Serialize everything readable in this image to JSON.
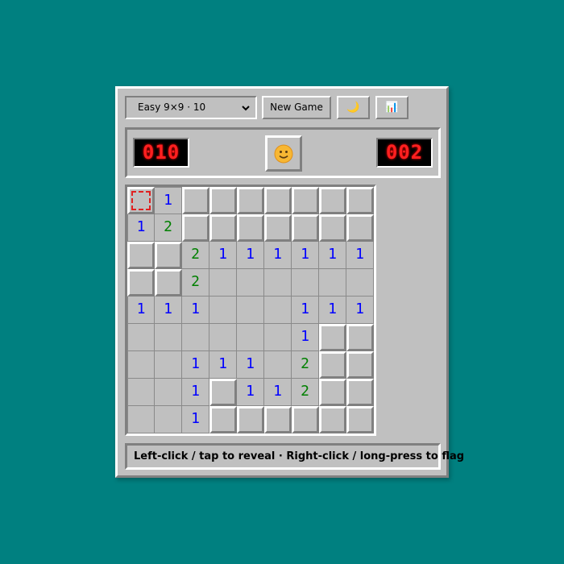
{
  "toolbar": {
    "difficulty_selected": "Easy 9×9 · 10",
    "new_game_label": "New Game",
    "theme_icon_name": "moon-icon",
    "theme_glyph": "🌙",
    "stats_icon_name": "bar-chart-icon",
    "stats_glyph": "📊"
  },
  "status": {
    "mines_remaining": "010",
    "timer": "002",
    "face_icon_name": "smiley-face-icon"
  },
  "board": {
    "rows": 9,
    "cols": 9,
    "legend": "H = hidden tile, . = revealed empty, digit = revealed number",
    "cells": [
      [
        "H",
        "1",
        "H",
        "H",
        "H",
        "H",
        "H",
        "H",
        "H"
      ],
      [
        "1",
        "2",
        "H",
        "H",
        "H",
        "H",
        "H",
        "H",
        "H"
      ],
      [
        "H",
        "H",
        "2",
        "1",
        "1",
        "1",
        "1",
        "1",
        "1"
      ],
      [
        "H",
        "H",
        "2",
        ".",
        ".",
        ".",
        ".",
        ".",
        "."
      ],
      [
        "1",
        "1",
        "1",
        ".",
        ".",
        ".",
        "1",
        "1",
        "1"
      ],
      [
        ".",
        ".",
        ".",
        ".",
        ".",
        ".",
        "1",
        "H",
        "H"
      ],
      [
        ".",
        ".",
        "1",
        "1",
        "1",
        ".",
        "2",
        "H",
        "H"
      ],
      [
        ".",
        ".",
        "1",
        "H",
        "1",
        "1",
        "2",
        "H",
        "H"
      ],
      [
        ".",
        ".",
        "1",
        "H",
        "H",
        "H",
        "H",
        "H",
        "H"
      ]
    ],
    "focused_cell": [
      0,
      0
    ]
  },
  "hint": {
    "text": "Left-click / tap to reveal · Right-click / long-press to flag"
  },
  "colors": {
    "background": "#008080",
    "panel": "#c0c0c0",
    "lcd_digits": "#ff2020",
    "number_1": "#0000ff",
    "number_2": "#008000",
    "focus_outline": "#e02020"
  }
}
